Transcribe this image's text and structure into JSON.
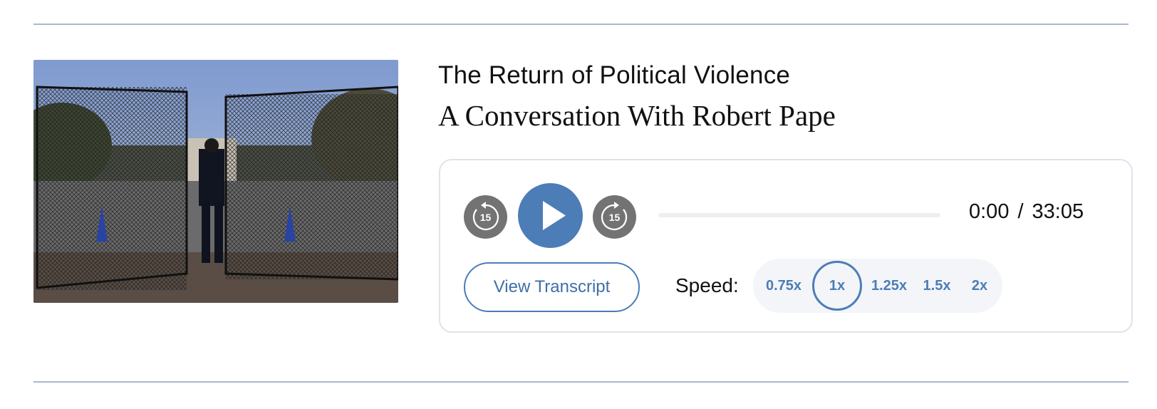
{
  "episode": {
    "title": "The Return of Political Violence",
    "subtitle": "A Conversation With Robert Pape",
    "thumbnail_alt": "Police officer at a fenced gate"
  },
  "player": {
    "skip_back_seconds": "15",
    "skip_forward_seconds": "15",
    "current_time": "0:00",
    "separator": "/",
    "duration": "33:05",
    "progress": 0,
    "transcript_label": "View Transcript",
    "speed_label": "Speed:",
    "speed_options": [
      "0.75x",
      "1x",
      "1.25x",
      "1.5x",
      "2x"
    ],
    "selected_speed": "1x"
  },
  "colors": {
    "accent": "#4c7db6",
    "skip_button": "#737373",
    "rule": "#a9b8cc",
    "border": "#dfe3ea"
  }
}
